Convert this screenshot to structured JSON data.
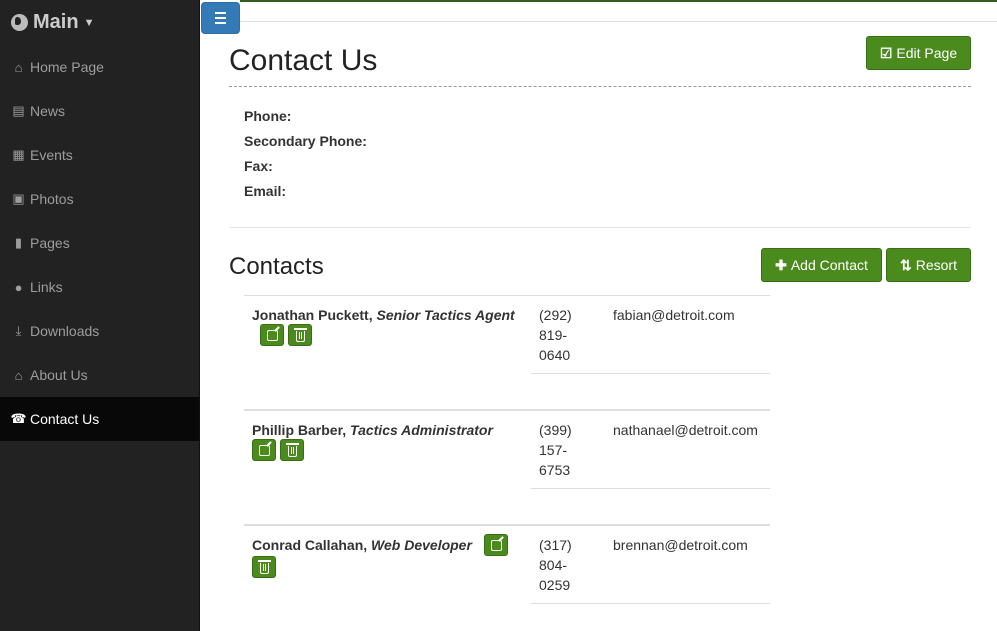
{
  "sidebar": {
    "brand": "Main",
    "items": [
      {
        "label": "Home Page",
        "icon": "home-icon"
      },
      {
        "label": "News",
        "icon": "newspaper-icon"
      },
      {
        "label": "Events",
        "icon": "calendar-icon"
      },
      {
        "label": "Photos",
        "icon": "picture-icon"
      },
      {
        "label": "Pages",
        "icon": "file-icon"
      },
      {
        "label": "Links",
        "icon": "globe-icon"
      },
      {
        "label": "Downloads",
        "icon": "download-icon"
      },
      {
        "label": "About Us",
        "icon": "bank-icon"
      },
      {
        "label": "Contact Us",
        "icon": "phone-icon",
        "active": true
      }
    ]
  },
  "page": {
    "title": "Contact Us",
    "edit_label": "Edit Page"
  },
  "info": {
    "phone": "Phone:",
    "secondary_phone": "Secondary Phone:",
    "fax": "Fax:",
    "email": "Email:"
  },
  "contacts": {
    "title": "Contacts",
    "add_label": "Add Contact",
    "resort_label": "Resort",
    "rows": [
      {
        "name": "Jonathan Puckett,",
        "role": "Senior Tactics Agent",
        "phone": "(292) 819-0640",
        "email": "fabian@detroit.com"
      },
      {
        "name": "Phillip Barber,",
        "role": "Tactics Administrator",
        "phone": "(399) 157-6753",
        "email": "nathanael@detroit.com"
      },
      {
        "name": "Conrad Callahan,",
        "role": "Web Developer",
        "phone": "(317) 804-0259",
        "email": "brennan@detroit.com"
      }
    ]
  },
  "colors": {
    "sidebar_bg": "#222222",
    "active_bg": "#080808",
    "button_green": "#4b8b1e",
    "toggle_blue": "#337ab7"
  }
}
